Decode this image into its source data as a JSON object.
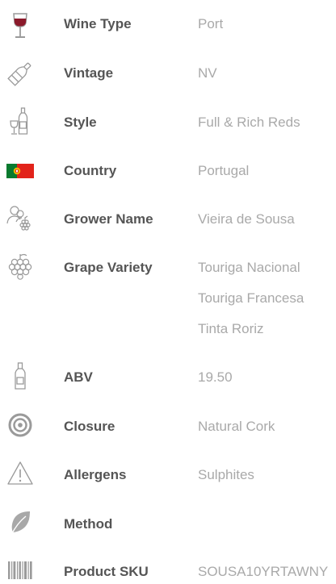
{
  "specs": [
    {
      "label": "Wine Type",
      "value": "Port",
      "icon": "wine-glass-icon"
    },
    {
      "label": "Vintage",
      "value": "NV",
      "icon": "wine-bottle-tilted-icon"
    },
    {
      "label": "Style",
      "value": "Full & Rich Reds",
      "icon": "bottle-and-glass-icon"
    },
    {
      "label": "Country",
      "value": "Portugal",
      "icon": "portugal-flag-icon"
    },
    {
      "label": "Grower Name",
      "value": "Vieira de Sousa",
      "icon": "grower-icon"
    },
    {
      "label": "Grape Variety",
      "values": [
        "Touriga Nacional",
        "Touriga Francesa",
        "Tinta Roriz"
      ],
      "icon": "grape-cluster-icon"
    },
    {
      "label": "ABV",
      "value": "19.50",
      "icon": "bottle-icon"
    },
    {
      "label": "Closure",
      "value": "Natural Cork",
      "icon": "cork-target-icon"
    },
    {
      "label": "Allergens",
      "value": "Sulphites",
      "icon": "warning-icon"
    },
    {
      "label": "Method",
      "value": "",
      "icon": "leaf-icon"
    },
    {
      "label": "Product SKU",
      "value": "SOUSA10YRTAWNY",
      "icon": "barcode-icon"
    }
  ],
  "colors": {
    "label": "#555555",
    "value": "#a9a9a9",
    "icon": "#9a9a9a",
    "wine": "#8b1a2b",
    "flag_green": "#0a7a2f",
    "flag_red": "#e2231a"
  }
}
